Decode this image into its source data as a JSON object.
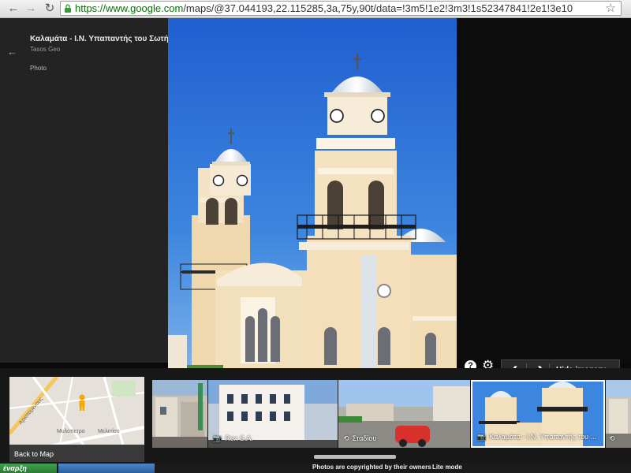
{
  "browser": {
    "url_scheme": "https://",
    "url_host": "www.google.com",
    "url_path": "/maps/@37.044193,22.115285,3a,75y,90t/data=!3m5!1e2!3m3!1s52347841!2e1!3e10",
    "back_icon": "arrow-left-icon",
    "forward_icon": "arrow-right-icon",
    "reload_icon": "reload-icon",
    "bookmark_icon": "star-icon"
  },
  "sidebar": {
    "title": "Καλαμάτα - Ι.Ν. Υπαπαντής του Σωτήρος",
    "author": "Tasos Geo",
    "type_label": "Photo"
  },
  "controls": {
    "help_label": "?",
    "hide_imagery_label": "Hide imagery"
  },
  "filmstrip": {
    "back_to_map_label": "Back to Map",
    "map_labels": [
      "Αριστομένους",
      "Μυλοπετρα",
      "Μελετίου"
    ],
    "thumbnails": [
      {
        "caption": "",
        "kind": "photo"
      },
      {
        "caption": "Rex S.A.",
        "kind": "photo"
      },
      {
        "caption": "Σταδίου",
        "kind": "street-view"
      },
      {
        "caption": "Καλαμάτα - Ι.Ν. Υπαπαντής του ...",
        "kind": "photo"
      },
      {
        "caption": "",
        "kind": "street-view"
      }
    ]
  },
  "footer": {
    "copyright": "Photos are copyrighted by their owners",
    "lite_mode": "Lite mode",
    "taskbar_label": "έναρξη"
  },
  "colors": {
    "panel": "#232324",
    "sky": "#2d6fd6",
    "facade": "#f1dcb6",
    "accent_green": "#0b6e0b"
  }
}
